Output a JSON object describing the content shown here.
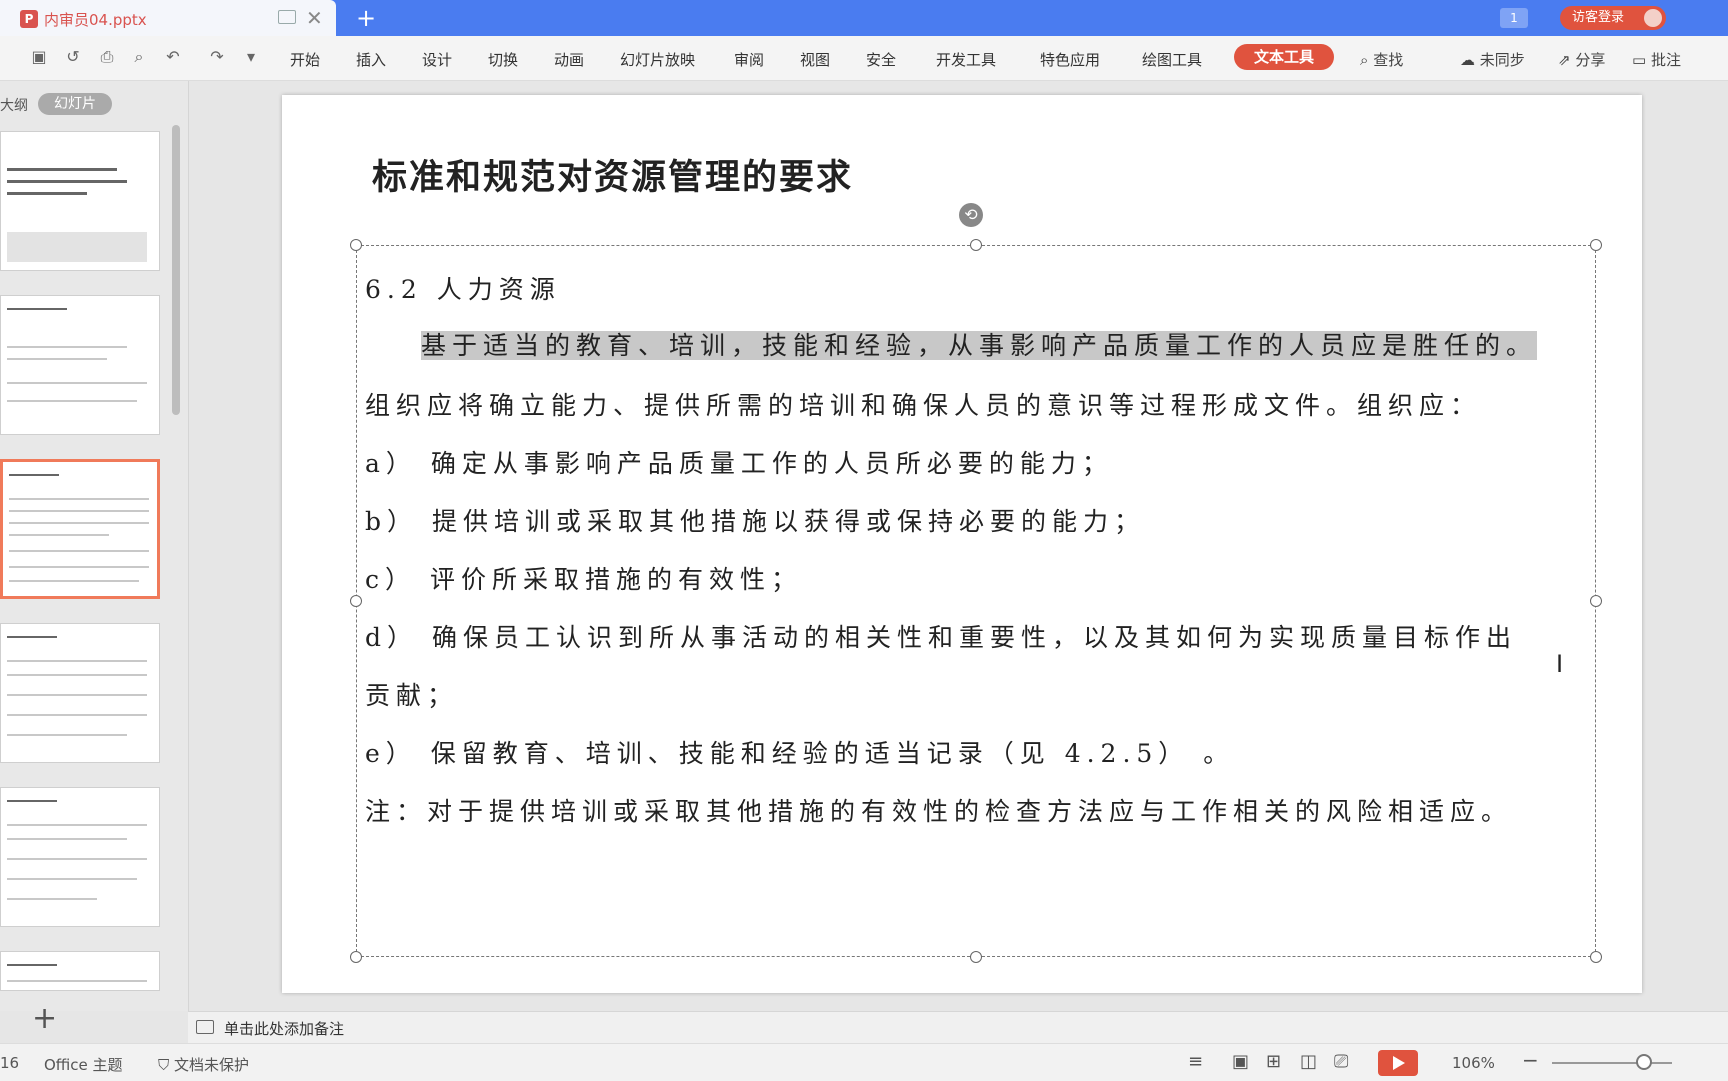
{
  "tabbar": {
    "doc_title": "内审员04.pptx",
    "new_tab": "+",
    "badge": "1",
    "guest_login": "访客登录"
  },
  "toolbar": {
    "menus": [
      "开始",
      "插入",
      "设计",
      "切换",
      "动画",
      "幻灯片放映",
      "审阅",
      "视图",
      "安全",
      "开发工具",
      "特色应用",
      "绘图工具"
    ],
    "active_tab": "文本工具",
    "find": "查找",
    "sync": "未同步",
    "share": "分享",
    "comment": "批注"
  },
  "leftpanel": {
    "outline_tab": "大纲",
    "slides_tab": "幻灯片"
  },
  "slide": {
    "title": "标准和规范对资源管理的要求",
    "section": "6.2  人力资源",
    "p1": "基于适当的教育、培训，技能和经验，从事影响产品质量工作的人员应是胜任的。",
    "p2": "组织应将确立能力、提供所需的培训和确保人员的意识等过程形成文件。组织应：",
    "a": "a） 确定从事影响产品质量工作的人员所必要的能力；",
    "b": "b） 提供培训或采取其他措施以获得或保持必要的能力；",
    "c": "c） 评价所采取措施的有效性；",
    "d1": "d） 确保员工认识到所从事活动的相关性和重要性，以及其如何为实现质量目标作出",
    "d2": "贡献；",
    "e": "e） 保留教育、培训、技能和经验的适当记录（见 4.2.5） 。",
    "note": "注：对于提供培训或采取其他措施的有效性的检查方法应与工作相关的风险相适应。"
  },
  "notes": {
    "placeholder": "单击此处添加备注"
  },
  "statusbar": {
    "slide_num": "16",
    "theme": "Office 主题",
    "protect": "文档未保护",
    "zoom": "106%"
  },
  "colors": {
    "accent_blue": "#4a7cf0",
    "accent_red": "#e0533e",
    "highlight_gray": "#c8c8c8"
  }
}
